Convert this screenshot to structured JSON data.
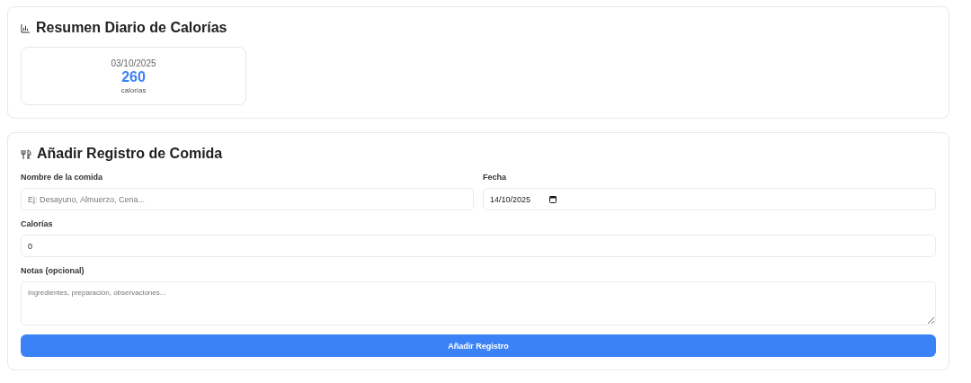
{
  "summary": {
    "title": "Resumen Diario de Calorías",
    "days": [
      {
        "date": "03/10/2025",
        "total": "260",
        "unit": "calorías"
      }
    ]
  },
  "form": {
    "title": "Añadir Registro de Comida",
    "name_field": {
      "label": "Nombre de la comida",
      "placeholder": "Ej: Desayuno, Almuerzo, Cena..."
    },
    "date_field": {
      "label": "Fecha",
      "value": "14/10/2025"
    },
    "calories_field": {
      "label": "Calorías",
      "value": "0"
    },
    "notes_field": {
      "label": "Notas (opcional)",
      "placeholder": "Ingredientes, preparación, observaciones..."
    },
    "submit": "Añadir Registro"
  }
}
